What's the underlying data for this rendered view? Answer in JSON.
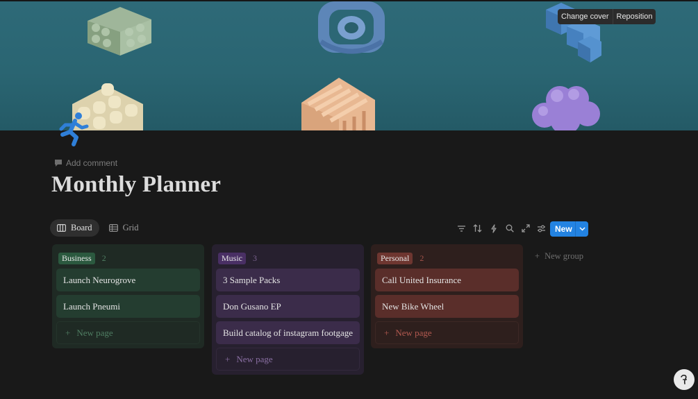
{
  "cover": {
    "change_cover_label": "Change cover",
    "reposition_label": "Reposition"
  },
  "page": {
    "add_comment_label": "Add comment",
    "title": "Monthly Planner",
    "icon": "running-figure-icon"
  },
  "views": [
    {
      "label": "Board",
      "icon": "board-icon",
      "active": true
    },
    {
      "label": "Grid",
      "icon": "table-icon",
      "active": false
    }
  ],
  "toolbar": {
    "tools": [
      "filter-icon",
      "sort-icon",
      "lightning-icon",
      "search-icon",
      "expand-icon",
      "settings-sliders-icon"
    ],
    "new_label": "New"
  },
  "board": {
    "groups": [
      {
        "tag": "Business",
        "count": "2",
        "color": "#2b593f",
        "cards": [
          "Launch Neurogrove",
          "Launch Pneumi"
        ],
        "new_page_label": "New page"
      },
      {
        "tag": "Music",
        "count": "3",
        "color": "#492f64",
        "cards": [
          "3 Sample Packs",
          "Don Gusano EP",
          "Build catalog of instagram  footgage"
        ],
        "new_page_label": "New page"
      },
      {
        "tag": "Personal",
        "count": "2",
        "color": "#6e3630",
        "cards": [
          "Call United Insurance",
          "New Bike Wheel"
        ],
        "new_page_label": "New page"
      }
    ],
    "new_group_label": "New group"
  }
}
